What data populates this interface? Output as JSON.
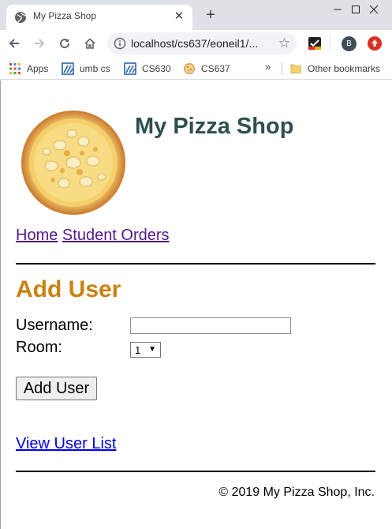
{
  "browser": {
    "tab_title": "My Pizza Shop",
    "address": "localhost/cs637/eoneil1/...",
    "profile_initial": "B",
    "bookmarks": [
      {
        "label": "Apps",
        "icon": "apps-grid-icon"
      },
      {
        "label": "umb cs",
        "icon": "bookmark-favicon-icon"
      },
      {
        "label": "CS630",
        "icon": "bookmark-favicon-icon"
      },
      {
        "label": "CS637",
        "icon": "pizza-favicon-icon"
      }
    ],
    "bookmarks_overflow": "»",
    "other_bookmarks": "Other bookmarks"
  },
  "page": {
    "site_title": "My Pizza Shop",
    "nav_links": [
      "Home",
      "Student Orders"
    ],
    "section_title": "Add User",
    "form": {
      "username_label": "Username:",
      "username_value": "",
      "room_label": "Room:",
      "room_selected": "1",
      "submit_label": "Add User"
    },
    "view_list_link": "View User List",
    "footer": "© 2019 My Pizza Shop, Inc."
  },
  "colors": {
    "title": "#2f4f4f",
    "section_title": "#c98211",
    "visited_link": "#551a8b",
    "link": "#0000ee"
  }
}
